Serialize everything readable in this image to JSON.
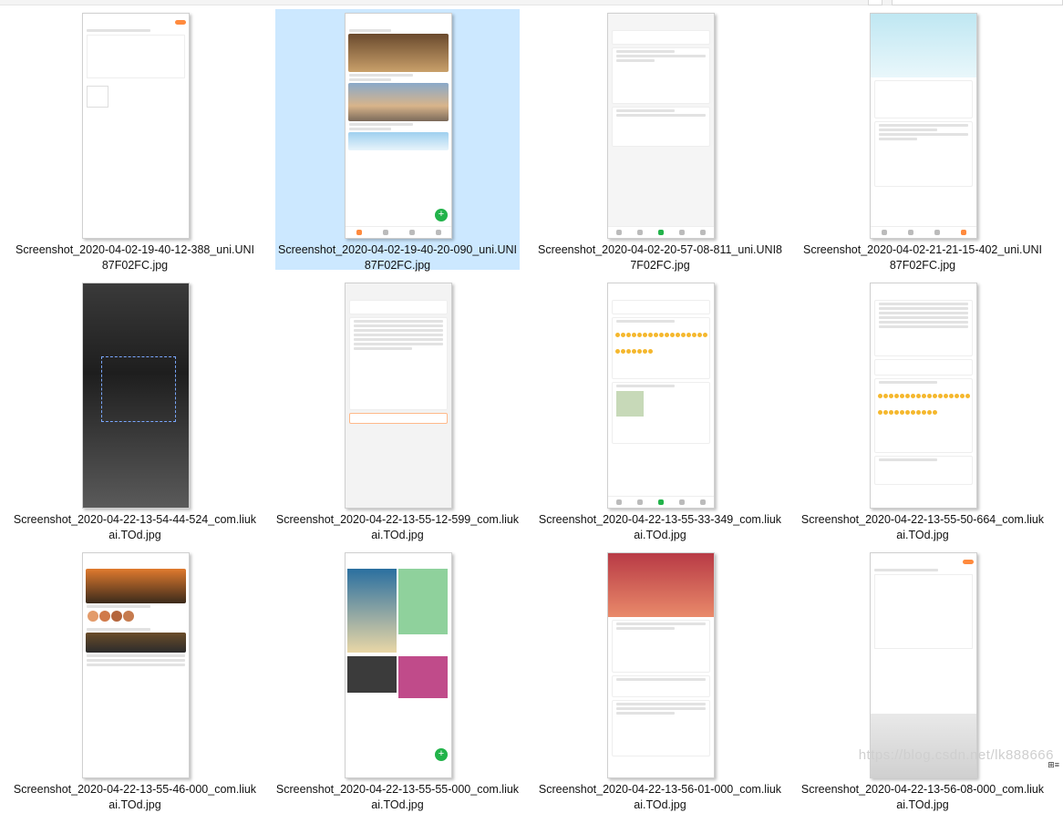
{
  "window": {
    "watermark": "https://blog.csdn.net/lk888666",
    "corner_glyph": "⊞≡"
  },
  "files": [
    {
      "name": "Screenshot_2020-04-02-19-40-12-388_uni.UNI87F02FC.jpg",
      "selected": false,
      "variant": "editor"
    },
    {
      "name": "Screenshot_2020-04-02-19-40-20-090_uni.UNI87F02FC.jpg",
      "selected": true,
      "variant": "feed"
    },
    {
      "name": "Screenshot_2020-04-02-20-57-08-811_uni.UNI87F02FC.jpg",
      "selected": false,
      "variant": "posts"
    },
    {
      "name": "Screenshot_2020-04-02-21-21-15-402_uni.UNI87F02FC.jpg",
      "selected": false,
      "variant": "profile"
    },
    {
      "name": "Screenshot_2020-04-22-13-54-44-524_com.liukai.TOd.jpg",
      "selected": false,
      "variant": "camera"
    },
    {
      "name": "Screenshot_2020-04-22-13-55-12-599_com.liukai.TOd.jpg",
      "selected": false,
      "variant": "settings"
    },
    {
      "name": "Screenshot_2020-04-22-13-55-33-349_com.liukai.TOd.jpg",
      "selected": false,
      "variant": "emoji"
    },
    {
      "name": "Screenshot_2020-04-22-13-55-50-664_com.liukai.TOd.jpg",
      "selected": false,
      "variant": "calendar"
    },
    {
      "name": "Screenshot_2020-04-22-13-55-46-000_com.liukai.TOd.jpg",
      "selected": false,
      "variant": "discover"
    },
    {
      "name": "Screenshot_2020-04-22-13-55-55-000_com.liukai.TOd.jpg",
      "selected": false,
      "variant": "waterfall"
    },
    {
      "name": "Screenshot_2020-04-22-13-56-01-000_com.liukai.TOd.jpg",
      "selected": false,
      "variant": "mine"
    },
    {
      "name": "Screenshot_2020-04-22-13-56-08-000_com.liukai.TOd.jpg",
      "selected": false,
      "variant": "keyboard"
    }
  ],
  "colors": {
    "accent_orange": "#ff8a3d",
    "accent_green": "#22b34a",
    "selection": "#cce8ff"
  }
}
